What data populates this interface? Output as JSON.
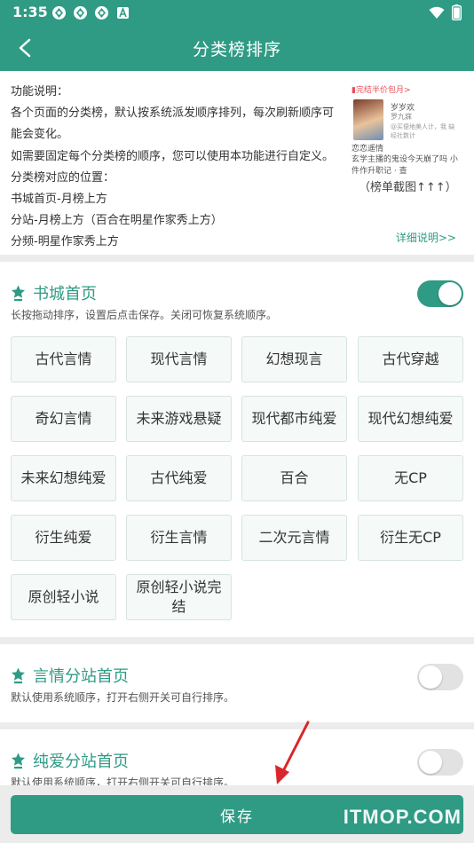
{
  "status_bar": {
    "time": "1:35",
    "icons": [
      "ai-ring-icon",
      "ai-ring-icon",
      "ai-ring-icon",
      "a-box-icon"
    ],
    "right_icons": [
      "wifi-icon",
      "battery-icon"
    ]
  },
  "app_bar": {
    "title": "分类榜排序",
    "back_icon": "back-arrow-icon"
  },
  "description": {
    "lines": [
      "功能说明：",
      "各个页面的分类榜，默认按系统派发顺序排列，每次刷新顺序可",
      "能会变化。",
      "如需要固定每个分类榜的顺序，您可以使用本功能进行自定义。",
      "分类榜对应的位置：",
      "书城首页-月榜上方",
      "分站-月榜上方（百合在明星作家秀上方）",
      "分频-明星作家秀上方"
    ],
    "preview": {
      "tag": "▮完结半价包月>",
      "book_title": "岁岁欢",
      "book_author": "罗九寐",
      "book_blurb": "@买便地美人计，我 缺经社数计",
      "line_a": "恋恋遥情",
      "line_b": "玄学主播的鬼设今天崩了吗 小件作升职记 · 查",
      "caption": "（榜单截图↑↑↑）"
    },
    "detail_link": "详细说明>>"
  },
  "sections": [
    {
      "title": "书城首页",
      "desc": "长按拖动排序，设置后点击保存。关闭可恢复系统顺序。",
      "toggle_on": true,
      "tags": [
        "古代言情",
        "现代言情",
        "幻想现言",
        "古代穿越",
        "奇幻言情",
        "未来游戏悬疑",
        "现代都市纯爱",
        "现代幻想纯爱",
        "未来幻想纯爱",
        "古代纯爱",
        "百合",
        "无CP",
        "衍生纯爱",
        "衍生言情",
        "二次元言情",
        "衍生无CP",
        "原创轻小说",
        "原创轻小说完结"
      ]
    },
    {
      "title": "言情分站首页",
      "desc": "默认使用系统顺序，打开右侧开关可自行排序。",
      "toggle_on": false
    },
    {
      "title": "纯爱分站首页",
      "desc": "默认使用系统顺序，打开右侧开关可自行排序。",
      "toggle_on": false
    }
  ],
  "save_label": "保存",
  "watermark": "ITMOP.COM",
  "colors": {
    "primary": "#2f9b84",
    "background": "#ececec",
    "accent_red": "#e8505b",
    "annotation_arrow": "#d9262c"
  }
}
